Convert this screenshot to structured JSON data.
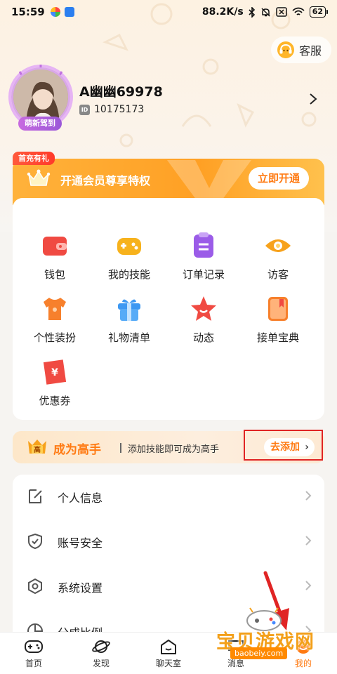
{
  "status_bar": {
    "time": "15:59",
    "network_speed": "88.2K/s",
    "battery": "62"
  },
  "header": {
    "service_label": "客服"
  },
  "profile": {
    "avatar_badge": "萌新驾到",
    "username": "A幽幽69978",
    "id_chip": "ID",
    "user_id": "10175173"
  },
  "vip": {
    "tag": "首充有礼",
    "text": "开通会员尊享特权",
    "button": "立即开通"
  },
  "grid": {
    "items": [
      {
        "label": "钱包",
        "icon": "wallet-icon",
        "color": "#f04a42"
      },
      {
        "label": "我的技能",
        "icon": "gamepad-icon",
        "color": "#f7b21c"
      },
      {
        "label": "订单记录",
        "icon": "clipboard-icon",
        "color": "#9b5ce8"
      },
      {
        "label": "访客",
        "icon": "eye-icon",
        "color": "#f7a21c"
      },
      {
        "label": "个性装扮",
        "icon": "tshirt-icon",
        "color": "#f7802c"
      },
      {
        "label": "礼物清单",
        "icon": "gift-icon",
        "color": "#3d98f2"
      },
      {
        "label": "动态",
        "icon": "star-icon",
        "color": "#f04a42"
      },
      {
        "label": "接单宝典",
        "icon": "book-icon",
        "color": "#f7802c"
      },
      {
        "label": "优惠券",
        "icon": "coupon-icon",
        "color": "#f04a42"
      }
    ]
  },
  "expert": {
    "badge": "高",
    "title": "成为高手",
    "desc": "添加技能即可成为高手",
    "button": "去添加"
  },
  "settings": {
    "items": [
      {
        "label": "个人信息",
        "icon": "edit-icon"
      },
      {
        "label": "账号安全",
        "icon": "shield-icon"
      },
      {
        "label": "系统设置",
        "icon": "settings-icon"
      },
      {
        "label": "分成比例",
        "icon": "pie-chart-icon"
      }
    ]
  },
  "tabbar": {
    "tabs": [
      {
        "label": "首页",
        "icon": "gamepad-icon"
      },
      {
        "label": "发现",
        "icon": "planet-icon"
      },
      {
        "label": "聊天室",
        "icon": "house-icon"
      },
      {
        "label": "消息",
        "icon": "message-icon"
      },
      {
        "label": "我的",
        "icon": "profile-icon",
        "active": true
      }
    ],
    "active_color": "#ff7a12"
  },
  "watermark": {
    "title": "宝贝游戏网",
    "url": "baobeiy.com"
  }
}
